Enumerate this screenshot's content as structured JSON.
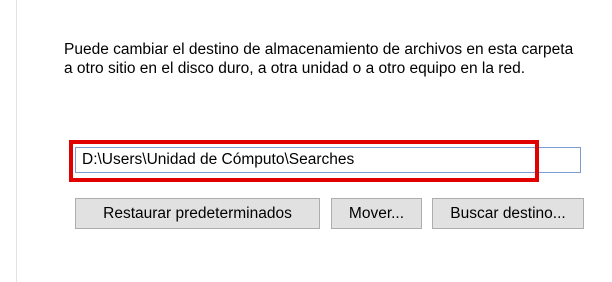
{
  "location": {
    "description": "Puede cambiar el destino de almacenamiento de archivos en esta carpeta a otro sitio en el disco duro, a otra unidad o a otro equipo en la red.",
    "path_value": "D:\\Users\\Unidad de Cómputo\\Searches",
    "highlight_color": "#e00000"
  },
  "buttons": {
    "restore_label": "Restaurar predeterminados",
    "move_label": "Mover...",
    "find_target_label": "Buscar destino..."
  }
}
